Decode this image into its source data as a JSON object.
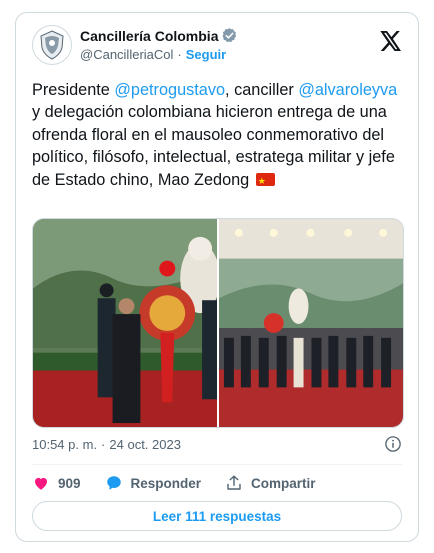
{
  "account": {
    "name": "Cancillería Colombia",
    "handle": "@CancilleriaCol",
    "separator": "·",
    "follow_label": "Seguir"
  },
  "tweet": {
    "text_part1": "Presidente ",
    "mention1": "@petrogustavo",
    "text_part2": ", canciller ",
    "mention2": "@alvaroleyva",
    "text_part3": " y delegación colombiana hicieron entrega de una ofrenda floral en el mausoleo conmemorativo del político, filósofo, intelectual, estratega militar y jefe de Estado chino, Mao Zedong "
  },
  "meta": {
    "time": "10:54 p. m.",
    "separator": "·",
    "date": "24 oct. 2023"
  },
  "actions": {
    "likes": "909",
    "reply_label": "Responder",
    "share_label": "Compartir"
  },
  "read_replies_label": "Leer 111 respuestas",
  "colors": {
    "accent": "#1d9bf0",
    "like_red": "#f91880",
    "text": "#0f1419",
    "muted": "#536471"
  },
  "icons": [
    "shield-avatar-icon",
    "verified-icon",
    "x-logo-icon",
    "china-flag-icon",
    "info-icon",
    "heart-icon",
    "reply-bubble-icon",
    "share-icon"
  ]
}
